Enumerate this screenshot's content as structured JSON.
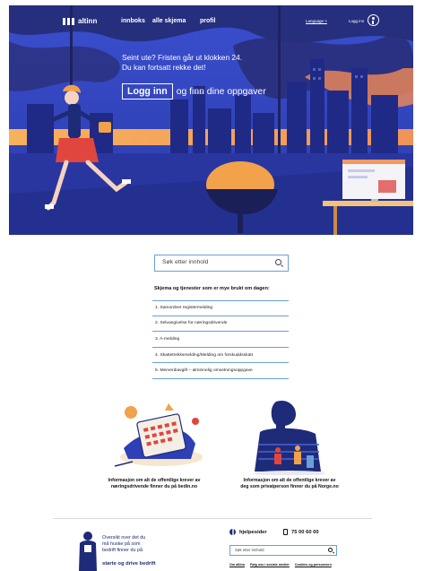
{
  "header": {
    "logo_text": "altinn",
    "nav": [
      "innboks",
      "alle skjema",
      "profil"
    ],
    "language_link": "Language >",
    "login_link": "Logg inn"
  },
  "hero": {
    "headline_line1": "Seint ute? Fristen går ut klokken 24.",
    "headline_line2": "Du kan fortsatt rekke det!",
    "login_button": "Logg inn",
    "cta_text": "og finn dine oppgaver"
  },
  "search": {
    "placeholder": "Søk etter innhold"
  },
  "popular": {
    "title": "Skjema og tjenester som er mye brukt om dagen:",
    "items": [
      "1. Samordnet registermelding",
      "2. Selvangivelse for næringsdrivende",
      "3. A-melding",
      "4. Skattetrekksmelding/Melding om forskuddsskatt",
      "5. Merverdiavgift – alminnelig omsetningsoppgave"
    ]
  },
  "info": {
    "business_line1": "Informasjon om alt de offentlige krever av",
    "business_line2": "næringsdrivende finner du på bedin.no",
    "private_line1": "Informasjon om alt de offentlige krever av",
    "private_line2": "deg som privatperson finner du på Norge.no"
  },
  "footer": {
    "overview_line1": "Oversikt over det du",
    "overview_line2": "må huske på som",
    "overview_line3": "bedrift finner du på",
    "overview_strong": "starte og drive bedrift",
    "help_label": "hjelpesider",
    "phone": "75 00 60 00",
    "search_placeholder": "Søk etter innhold",
    "links": [
      "Om altinn",
      "Følg oss i sosiale medier",
      "Cookies og personvern"
    ]
  },
  "colors": {
    "hero_blue": "#2f3fb6",
    "accent_orange": "#f2a24a",
    "link_blue": "#6a9fd8",
    "brand_navy": "#1e2b78"
  }
}
